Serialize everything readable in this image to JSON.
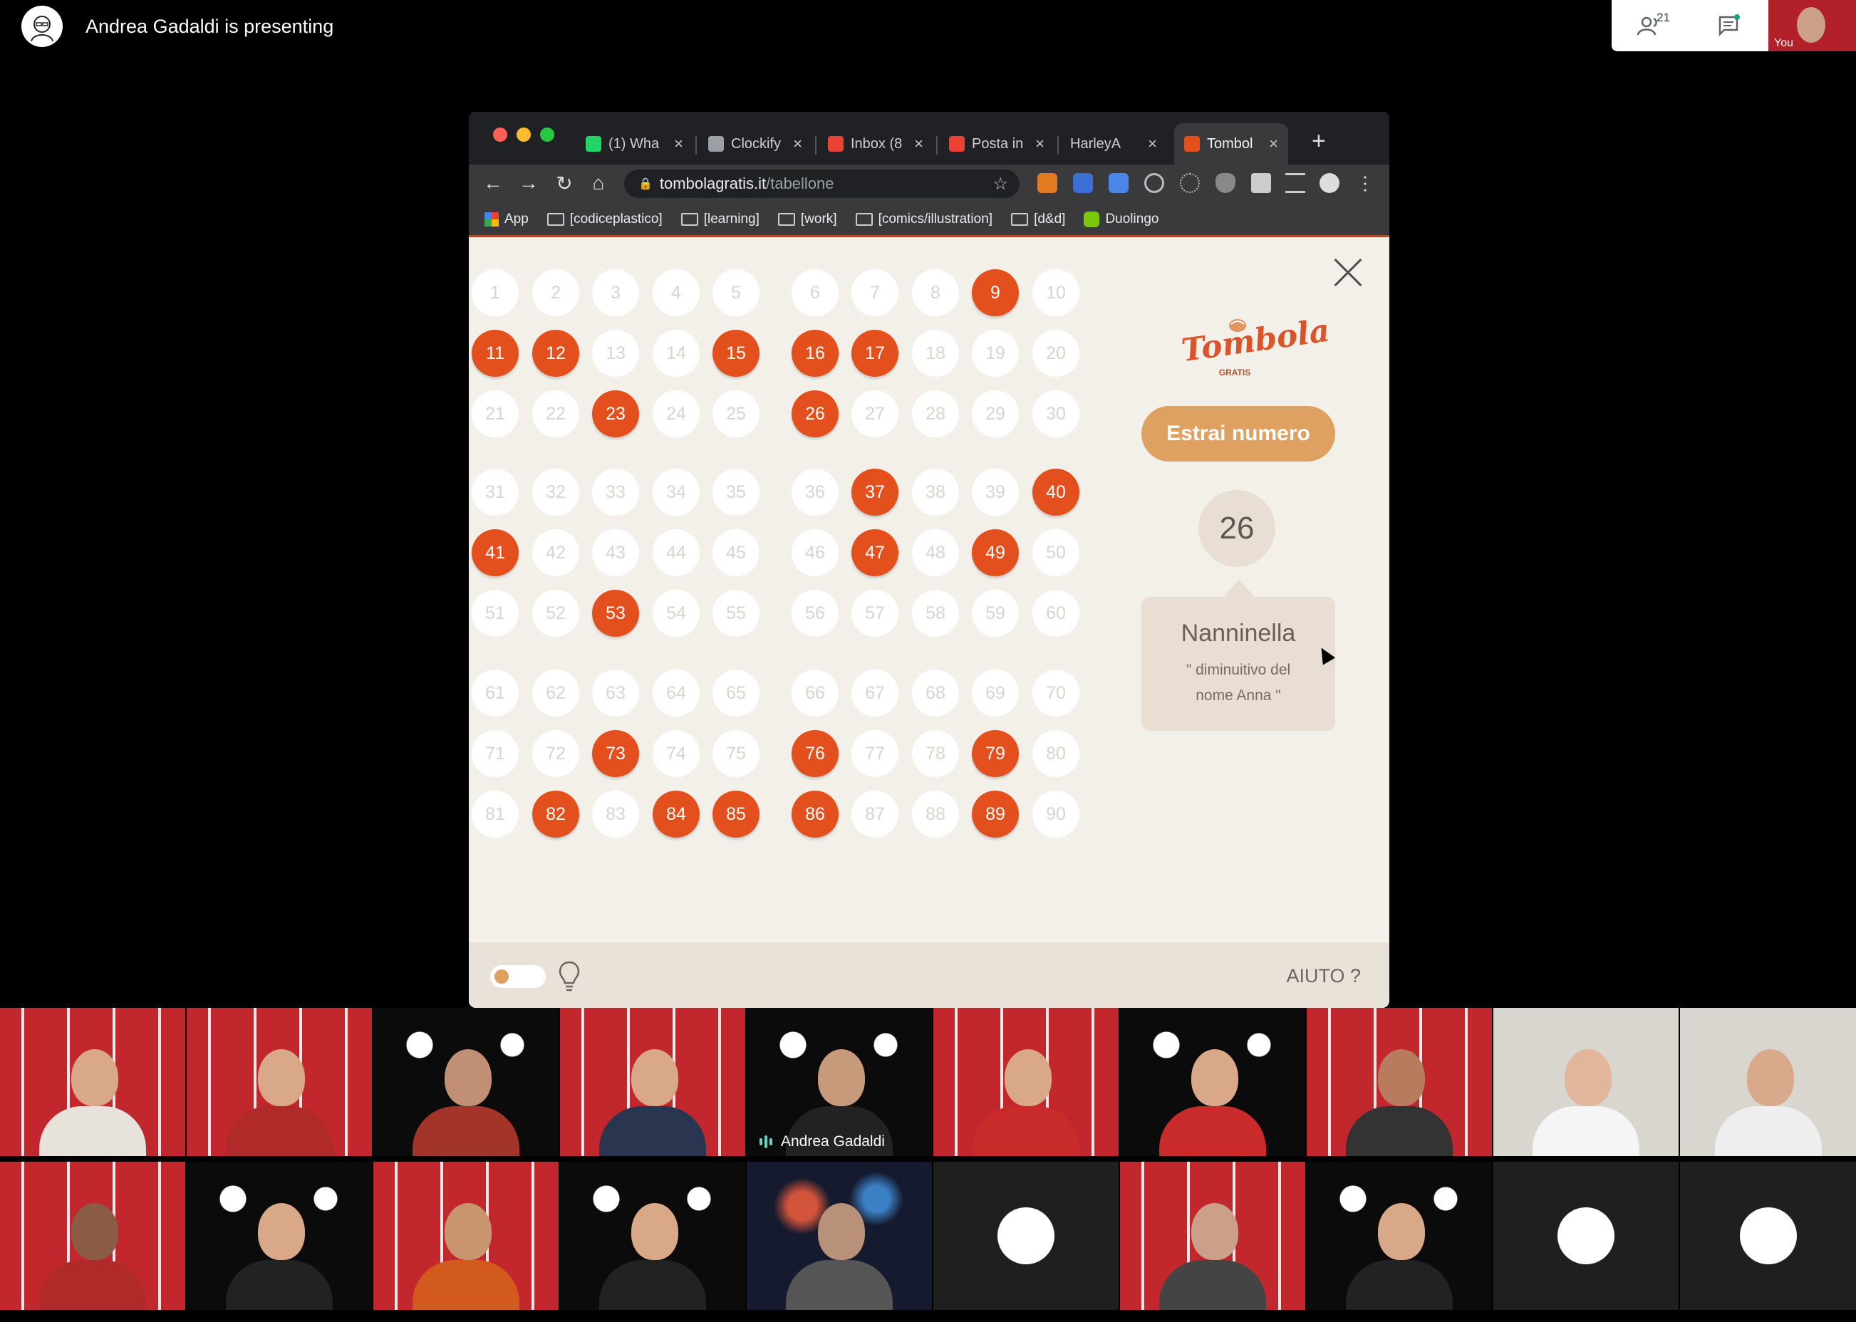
{
  "meet": {
    "presenter_text": "Andrea Gadaldi is presenting",
    "people_count": "21",
    "self_label": "You"
  },
  "browser": {
    "tabs": [
      {
        "label": "(1) Wha",
        "icon": "whatsapp-icon",
        "color": "#25d366"
      },
      {
        "label": "Clockify",
        "icon": "clockify-icon",
        "color": "#9aa0a6"
      },
      {
        "label": "Inbox (8",
        "icon": "gmail-icon",
        "color": "#ea4335"
      },
      {
        "label": "Posta in",
        "icon": "gmail-icon",
        "color": "#ea4335"
      },
      {
        "label": "HarleyA",
        "icon": "none",
        "color": "#777777"
      },
      {
        "label": "Tombol",
        "icon": "tombola-icon",
        "color": "#e4501d"
      }
    ],
    "url_domain": "tombolagratis.it",
    "url_path": "/tabellone",
    "bookmarks": [
      "App",
      "[codiceplastico]",
      "[learning]",
      "[work]",
      "[comics/illustration]",
      "[d&d]",
      "Duolingo"
    ]
  },
  "tombola": {
    "called_numbers": [
      9,
      11,
      12,
      15,
      16,
      17,
      23,
      26,
      37,
      40,
      41,
      47,
      49,
      53,
      73,
      76,
      79,
      82,
      84,
      85,
      86,
      89
    ],
    "logo_text": "Tombola",
    "logo_sub": "GRATIS",
    "draw_button": "Estrai numero",
    "current_number": "26",
    "current_name": "Nanninella",
    "current_meaning": "\" diminuitivo del nome Anna \"",
    "help_label": "AIUTO ?",
    "accent_color": "#e4501d",
    "button_color": "#dea162"
  },
  "participants": {
    "speaking_name": "Andrea Gadaldi"
  }
}
